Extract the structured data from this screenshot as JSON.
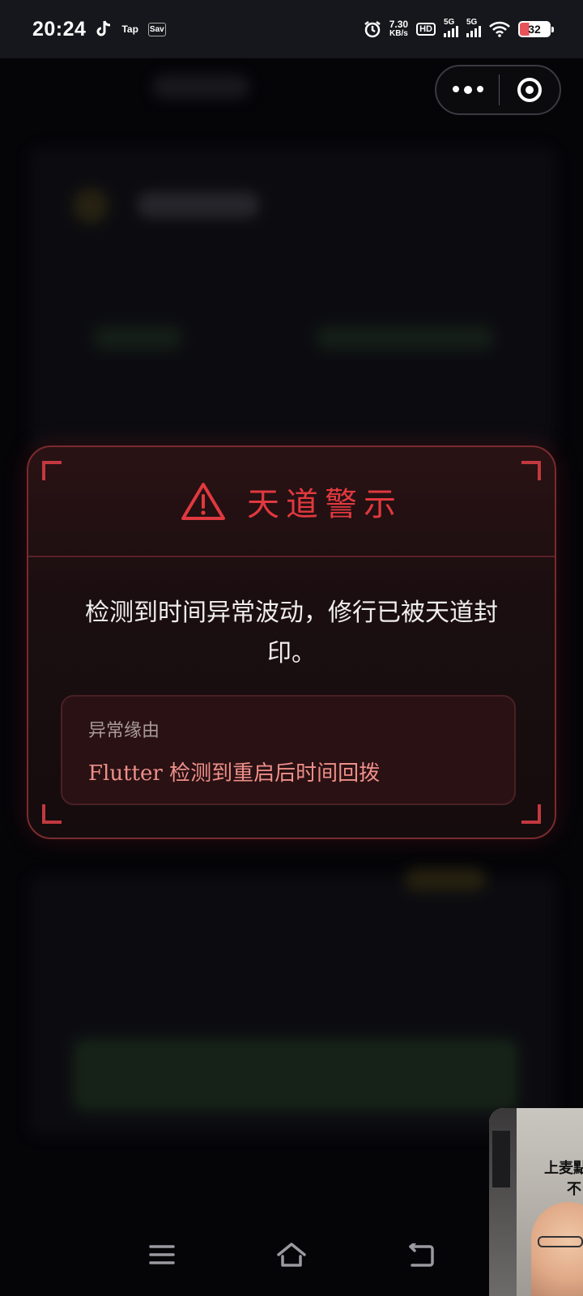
{
  "status_bar": {
    "time": "20:24",
    "apps": [
      "tiktok-icon",
      "Tap",
      "Sav"
    ],
    "net_speed_value": "7.30",
    "net_speed_unit": "KB/s",
    "hd_label": "HD",
    "sim1_label": "5G",
    "sim2_label": "5G",
    "battery": "32"
  },
  "dialog": {
    "title": "天道警示",
    "message": "检测到时间异常波动，修行已被天道封印。",
    "reason_label": "异常缘由",
    "reason_value": "Flutter 检测到重启后时间回拨"
  },
  "pip": {
    "caption_line1": "上麦點",
    "caption_line2": "不"
  },
  "colors": {
    "accent_red": "#e0393f",
    "dialog_bg": "#1a0e10",
    "reason_text": "#ee8f8a"
  }
}
